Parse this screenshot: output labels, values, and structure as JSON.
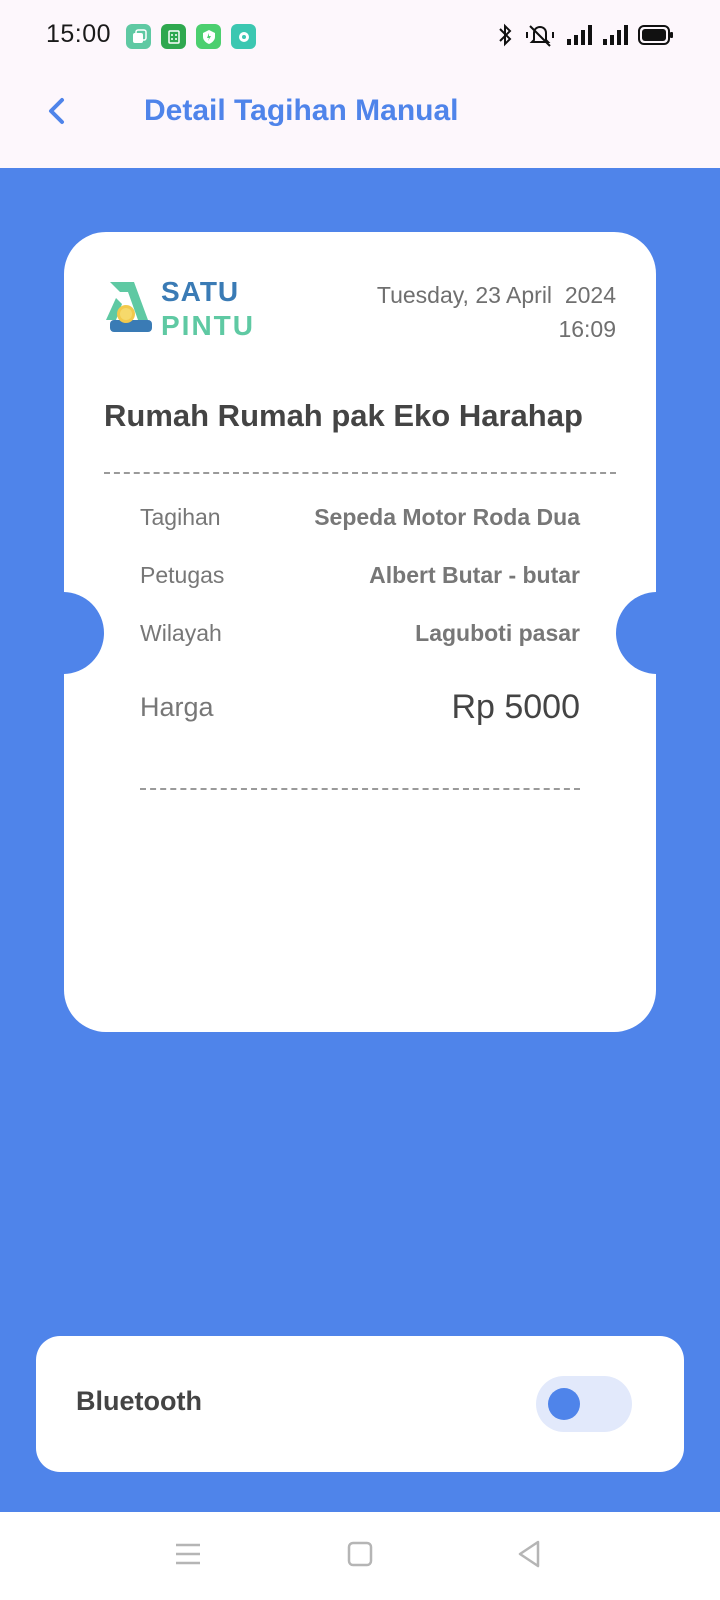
{
  "status_bar": {
    "time": "15:00",
    "app_icons": [
      "square-stack-icon",
      "calculator-icon",
      "shield-icon",
      "camera-icon"
    ],
    "right_icons": [
      "bluetooth-icon",
      "vibrate-icon",
      "signal-icon",
      "signal-icon",
      "battery-icon"
    ]
  },
  "app_bar": {
    "title": "Detail Tagihan Manual",
    "back_icon": "chevron-left-icon"
  },
  "ticket": {
    "logo": {
      "top": "SATU",
      "bottom": "PINTU"
    },
    "date": "Tuesday, 23 April  2024",
    "time": "16:09",
    "customer_name": "Rumah Rumah pak Eko Harahap",
    "rows": [
      {
        "label": "Tagihan",
        "value": "Sepeda Motor Roda Dua"
      },
      {
        "label": "Petugas",
        "value": "Albert Butar - butar"
      },
      {
        "label": "Wilayah",
        "value": "Laguboti pasar"
      },
      {
        "label": "Harga",
        "value": "Rp 5000"
      }
    ]
  },
  "bluetooth": {
    "label": "Bluetooth",
    "enabled": false
  },
  "nav_bar": {
    "items": [
      "menu-icon",
      "home-square-icon",
      "back-triangle-icon"
    ]
  },
  "colors": {
    "primary": "#4f84ea",
    "logo_blue": "#3a7bb5",
    "logo_green": "#5fc9a3"
  }
}
